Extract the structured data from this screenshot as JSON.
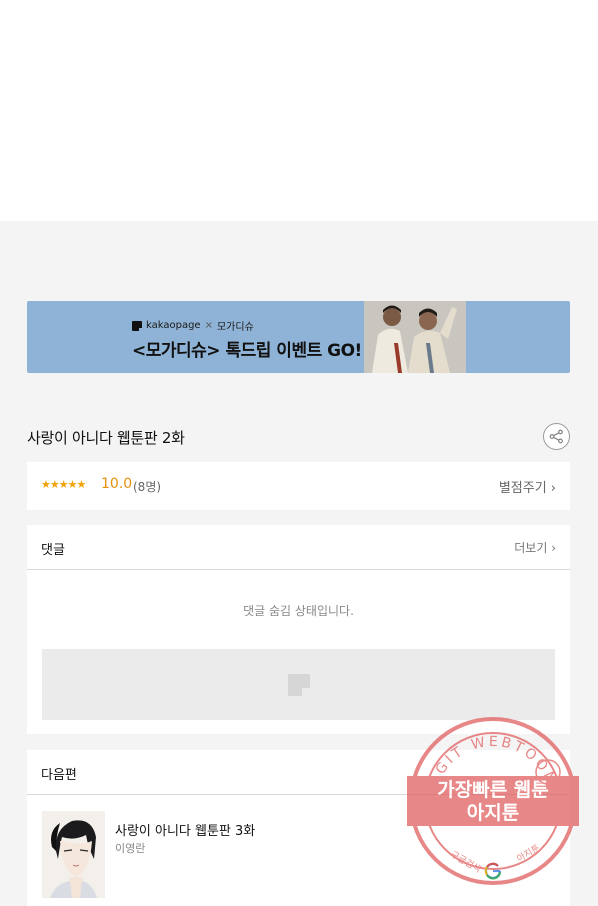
{
  "banner": {
    "brand": "kakaopage",
    "cross": "×",
    "partner": "모가디슈",
    "title": "<모가디슈> 톡드립 이벤트 GO!"
  },
  "episode": {
    "title": "사랑이 아니다 웹툰판 2화"
  },
  "rating": {
    "stars": "★★★★★",
    "score": "10.0",
    "count": "(8명)",
    "rate_label": "별점주기 ›"
  },
  "comments": {
    "header": "댓글",
    "more_label": "더보기 ›",
    "hidden_message": "댓글 숨김 상태입니다."
  },
  "next": {
    "header": "다음편",
    "title": "사랑이 아니다 웹툰판 3화",
    "author": "이영란"
  },
  "watermark": {
    "top_text": "AGIT WEBTOON",
    "main_line1": "가장빠른 웹툰",
    "main_line2": "아지툰",
    "bottom_left": "구글검색",
    "bottom_right": "아지툰"
  },
  "colors": {
    "banner_bg": "#8fb3d6",
    "star": "#f2a30c",
    "score": "#e8900c",
    "watermark_red": "#e04848"
  }
}
